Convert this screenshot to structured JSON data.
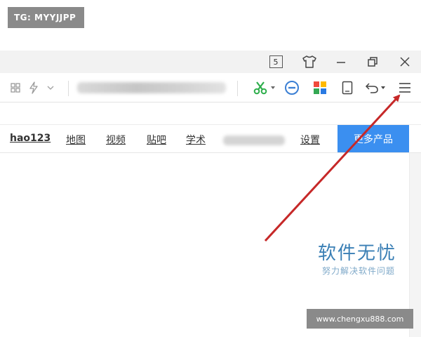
{
  "overlay": {
    "tag": "TG: MYYJJPP",
    "site": "www.chengxu888.com"
  },
  "titlebar": {
    "tab_count": "5",
    "icons": [
      "tshirt-icon",
      "minimize-icon",
      "restore-icon",
      "close-icon"
    ]
  },
  "toolbar": {
    "icons": [
      "grid-icon",
      "bolt-icon",
      "chevron-down-icon",
      "scissors-icon",
      "stop-icon",
      "apps-icon",
      "tablet-icon",
      "undo-icon",
      "menu-icon"
    ],
    "accent_colors": {
      "scissors": "#2dae4b",
      "stop": "#3b7fd4",
      "apps": [
        "#f04a3c",
        "#ffb900",
        "#34a853",
        "#2a7ae2"
      ]
    }
  },
  "navbar": {
    "links": [
      "hao123",
      "地图",
      "视频",
      "贴吧",
      "学术",
      "设置"
    ],
    "more_button": "更多产品",
    "button_color": "#3b8ff0"
  },
  "watermark": {
    "title": "软件无忧",
    "subtitle": "努力解决软件问题"
  },
  "annotation": {
    "arrow_color": "#c62828"
  }
}
